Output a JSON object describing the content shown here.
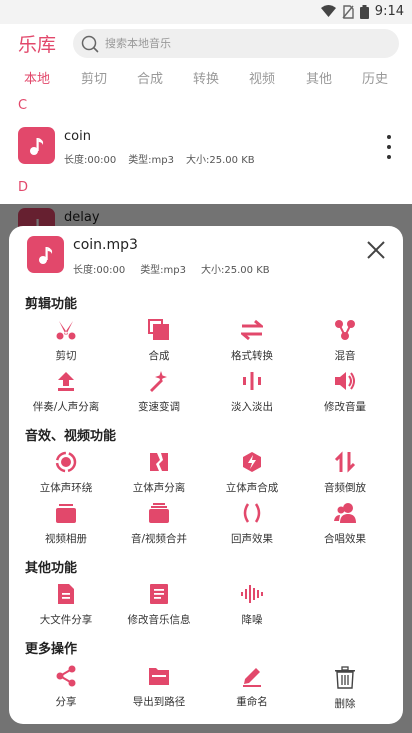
{
  "status": {
    "time": "9:14"
  },
  "app": {
    "title": "乐库"
  },
  "search": {
    "placeholder": "搜索本地音乐"
  },
  "tabs": [
    "本地",
    "剪切",
    "合成",
    "转换",
    "视频",
    "其他",
    "历史"
  ],
  "library": {
    "sections": [
      {
        "letter": "C",
        "song": {
          "title": "coin",
          "duration": "长度:00:00",
          "type": "类型:mp3",
          "size": "大小:25.00 KB"
        }
      },
      {
        "letter": "D",
        "song": {
          "title": "delay"
        }
      }
    ]
  },
  "sheet": {
    "file": {
      "title": "coin.mp3",
      "duration": "长度:00:00",
      "type": "类型:mp3",
      "size": "大小:25.00 KB"
    },
    "groups": [
      {
        "title": "剪辑功能",
        "items": [
          {
            "label": "剪切",
            "icon": "scissors-icon"
          },
          {
            "label": "合成",
            "icon": "merge-icon"
          },
          {
            "label": "格式转换",
            "icon": "convert-arrows-icon"
          },
          {
            "label": "混音",
            "icon": "mix-nodes-icon"
          },
          {
            "label": "伴奏/人声分离",
            "icon": "upload-arrow-icon"
          },
          {
            "label": "变速变调",
            "icon": "magic-wand-icon"
          },
          {
            "label": "淡入淡出",
            "icon": "waveform-bars-icon"
          },
          {
            "label": "修改音量",
            "icon": "speaker-volume-icon"
          }
        ]
      },
      {
        "title": "音效、视频功能",
        "items": [
          {
            "label": "立体声环绕",
            "icon": "surround-icon"
          },
          {
            "label": "立体声分离",
            "icon": "split-card-icon"
          },
          {
            "label": "立体声合成",
            "icon": "bolt-hexagon-icon"
          },
          {
            "label": "音频倒放",
            "icon": "reverse-arrows-icon"
          },
          {
            "label": "视频相册",
            "icon": "video-album-icon"
          },
          {
            "label": "音/视频合并",
            "icon": "stack-merge-icon"
          },
          {
            "label": "回声效果",
            "icon": "echo-parens-icon"
          },
          {
            "label": "合唱效果",
            "icon": "chorus-people-icon"
          }
        ]
      },
      {
        "title": "其他功能",
        "items": [
          {
            "label": "大文件分享",
            "icon": "file-share-icon"
          },
          {
            "label": "修改音乐信息",
            "icon": "music-info-icon"
          },
          {
            "label": "降噪",
            "icon": "noise-wave-icon"
          }
        ]
      },
      {
        "title": "更多操作",
        "items": [
          {
            "label": "分享",
            "icon": "share-icon"
          },
          {
            "label": "导出到路径",
            "icon": "export-folder-icon"
          },
          {
            "label": "重命名",
            "icon": "rename-pencil-icon"
          },
          {
            "label": "删除",
            "icon": "trash-icon"
          }
        ]
      }
    ]
  },
  "colors": {
    "accent": "#e2486b",
    "overlay": "rgba(0,0,0,0.55)"
  }
}
